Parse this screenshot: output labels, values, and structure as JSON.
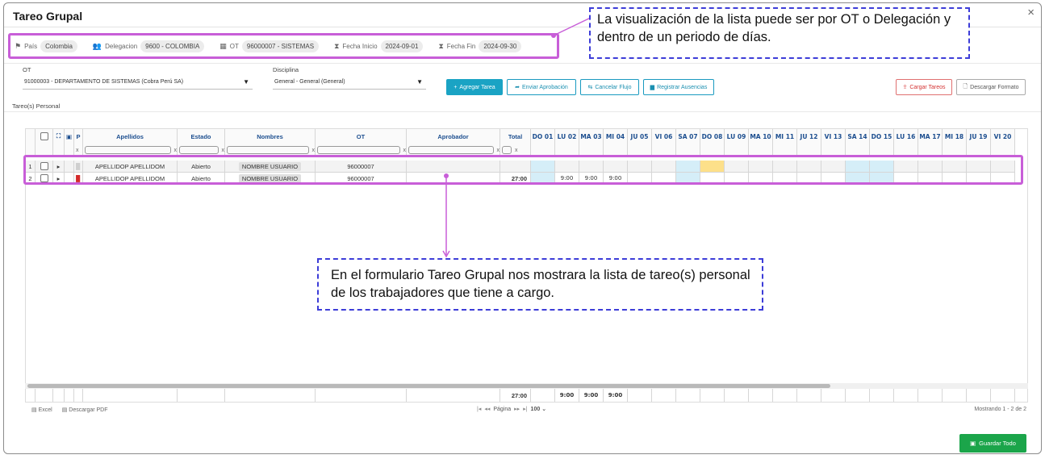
{
  "dialog": {
    "title": "Tareo Grupal",
    "close": "×"
  },
  "info": {
    "pais_label": "País",
    "pais_value": "Colombia",
    "delegacion_label": "Delegacion",
    "delegacion_value": "9600 - COLOMBIA",
    "ot_label": "OT",
    "ot_value": "96000007 - SISTEMAS",
    "fecha_inicio_label": "Fecha Inicio",
    "fecha_inicio_value": "2024-09-01",
    "fecha_fin_label": "Fecha Fin",
    "fecha_fin_value": "2024-09-30"
  },
  "callouts": {
    "top": "La visualización de la lista puede ser por OT o Delegación y dentro de un periodo de días.",
    "middle": "En el formulario Tareo Grupal nos mostrara la lista de tareo(s) personal de los trabajadores que tiene a cargo."
  },
  "filters": {
    "ot_label": "OT",
    "ot_value": "91000003 - DEPARTAMENTO DE SISTEMAS (Cobra Perú SA)",
    "disciplina_label": "Disciplina",
    "disciplina_value": "General - General (General)"
  },
  "buttons": {
    "agregar": "Agregar Tarea",
    "enviar": "Enviar Aprobación",
    "cancelar": "Cancelar Flujo",
    "registrar": "Registrar Ausencias",
    "cargar": "Cargar Tareos",
    "descargar": "Descargar Formato",
    "guardar": "Guardar Todo"
  },
  "section_label": "Tareo(s) Personal",
  "table": {
    "headers": {
      "p": "P",
      "apellidos": "Apellidos",
      "estado": "Estado",
      "nombres": "Nombres",
      "ot": "OT",
      "aprobador": "Aprobador",
      "total": "Total"
    },
    "days": [
      "DO 01",
      "LU 02",
      "MA 03",
      "MI 04",
      "JU 05",
      "VI 06",
      "SA 07",
      "DO 08",
      "LU 09",
      "MA 10",
      "MI 11",
      "JU 12",
      "VI 13",
      "SA 14",
      "DO 15",
      "LU 16",
      "MA 17",
      "MI 18",
      "JU 19",
      "VI 20"
    ],
    "filter_clear": "x",
    "rows": [
      {
        "n": "1",
        "apellidos": "APELLIDOP APELLIDOM",
        "estado": "Abierto",
        "nombres": "NOMBRE USUARIO",
        "ot": "96000007",
        "aprobador": "",
        "total": "",
        "days": [
          "",
          "",
          "",
          "",
          "",
          "",
          "",
          "",
          "",
          "",
          "",
          "",
          "",
          "",
          "",
          "",
          "",
          "",
          "",
          ""
        ]
      },
      {
        "n": "2",
        "apellidos": "APELLIDOP APELLIDOM",
        "estado": "Abierto",
        "nombres": "NOMBRE USUARIO",
        "ot": "96000007",
        "aprobador": "",
        "total": "27:00",
        "days": [
          "",
          "9:00",
          "9:00",
          "9:00",
          "",
          "",
          "",
          "",
          "",
          "",
          "",
          "",
          "",
          "",
          "",
          "",
          "",
          "",
          "",
          ""
        ]
      }
    ],
    "footer": {
      "total": "27:00",
      "days": [
        "",
        "9:00",
        "9:00",
        "9:00",
        "",
        "",
        "",
        "",
        "",
        "",
        "",
        "",
        "",
        "",
        "",
        "",
        "",
        "",
        "",
        ""
      ]
    }
  },
  "pager": {
    "excel": "Excel",
    "pdf": "Descargar PDF",
    "page_label": "Página",
    "page_size": "100",
    "summary": "Mostrando 1 - 2 de 2"
  },
  "colors": {
    "accent": "#1aa3c4",
    "highlight": "#c85ed8",
    "callout_border": "#3d3dd8",
    "save": "#1ba54a"
  }
}
